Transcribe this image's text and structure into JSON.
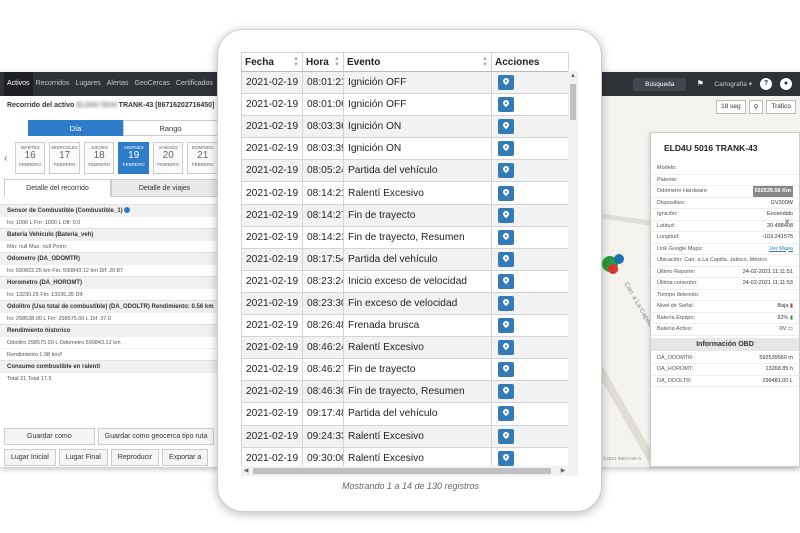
{
  "nav": {
    "tabs": [
      "Activos",
      "Recorridos",
      "Lugares",
      "Alertas",
      "GeoCercas",
      "Certificados"
    ],
    "search_label": "Búsqueda",
    "map_type_label": "Cartografía",
    "help_icon": "question-icon",
    "user_icon": "user-icon"
  },
  "route_panel": {
    "title_prefix": "Recorrido del activo",
    "title_blurred": "ELD4U 5016",
    "title_suffix": "TRANK-43 [86716202716450]",
    "mode_day": "Día",
    "mode_range": "Rango",
    "days": [
      {
        "name": "MARTES",
        "num": "16",
        "month": "FEBRERO"
      },
      {
        "name": "MIERCOLES",
        "num": "17",
        "month": "FEBRERO"
      },
      {
        "name": "JUEVES",
        "num": "18",
        "month": "FEBRERO"
      },
      {
        "name": "VIERNES",
        "num": "19",
        "month": "FEBRERO"
      },
      {
        "name": "SABADO",
        "num": "20",
        "month": "FEBRERO"
      },
      {
        "name": "DOMINGO",
        "num": "21",
        "month": "FEBRERO"
      }
    ],
    "tab_route_detail": "Detalle del recorrido",
    "tab_trip_detail": "Detalle de viajes",
    "sections": [
      {
        "title": "Sensor de Combustible (Combustible_1)",
        "row": "Ini:  1000 L   Fin:  1000 L   Dif:  0.0"
      },
      {
        "title": "Bateria Vehiculo (Bateria_veh)",
        "row": "Min:  null   Max:  null   Prom:"
      },
      {
        "title": "Odometro (DA_ODOMTR)",
        "row": "Ini:  590822.25 km   Fin:  590843.12 km   Dif:  20.87"
      },
      {
        "title": "Horometro (DA_HOROMT)",
        "row": "Ini:  13230.25   Fin:  13236.35   Dif:"
      },
      {
        "title": "Odolitro (Uso total de combustible) (DA_ODOLTR)  Rendimiento: 0.56 km",
        "row": "Ini:  298538.00 L   Fin:  298575.00 L   Dif:  37.0"
      },
      {
        "title": "Rendimiento historico",
        "row": "Odolitro  298575.00 L   Odometro  590843.12 km"
      },
      {
        "title": "",
        "row": "Rendimiento  1.98 km/l"
      },
      {
        "title": "Consumo combustible en ralenti",
        "row": "Total  21   Total  17.5"
      }
    ],
    "btn_save_as": "Guardar como",
    "btn_save_geofence": "Guardar como geocerca tipo ruta",
    "btn_start_place": "Lugar Inicial",
    "btn_end_place": "Lugar Final",
    "btn_replay": "Reproducir",
    "btn_export": "Exportar a"
  },
  "map": {
    "interval_label": "18 seg",
    "traffic_label": "Tráfico",
    "road_label": "Carr. a La Capilla",
    "attribution": "©2021 INEGI   50 m",
    "marker_badge": "20"
  },
  "vehicle_panel": {
    "title": "ELD4U 5016 TRANK-43",
    "rows": [
      {
        "label": "Modelo:",
        "value": ""
      },
      {
        "label": "Patente:",
        "value": ""
      },
      {
        "label": "Odómetro Hardware:",
        "value": "592539.56 Km",
        "style": "hl"
      },
      {
        "label": "Dispositivo:",
        "value": "GV300W"
      },
      {
        "label": "Ignición:",
        "value": "Encendido"
      },
      {
        "label": "Latitud:",
        "value": "20.488408"
      },
      {
        "label": "Longitud:",
        "value": "-103.241575"
      },
      {
        "label": "Link Google Maps:",
        "value": "Ver Mapa",
        "style": "link"
      },
      {
        "label": "Ubicación: Carr. a La Capilla, Jalisco, México",
        "value": ""
      },
      {
        "label": "Último Reporte:",
        "value": "24-02-2021 11:11:51"
      },
      {
        "label": "Última conexión:",
        "value": "24-02-2021 11:11:53"
      },
      {
        "label": "Tiempo detenido:",
        "value": ""
      },
      {
        "label": "Nivel de Señal:",
        "value": "Baja"
      },
      {
        "label": "Batería Equipo:",
        "value": "92%"
      },
      {
        "label": "Batería Activo:",
        "value": "0V"
      }
    ],
    "obd_title": "Información OBD",
    "obd_rows": [
      {
        "label": "DA_ODOMTR:",
        "value": "592539560 m"
      },
      {
        "label": "DA_HOROMT:",
        "value": "13268.85 h"
      },
      {
        "label": "DA_ODOLTR:",
        "value": "299481.00 L"
      }
    ]
  },
  "events_table": {
    "columns": [
      "Fecha",
      "Hora",
      "Evento",
      "Acciones"
    ],
    "rows": [
      {
        "date": "2021-02-19",
        "time": "08:01:21",
        "event": "Ignición OFF"
      },
      {
        "date": "2021-02-19",
        "time": "08:01:06",
        "event": "Ignición OFF"
      },
      {
        "date": "2021-02-19",
        "time": "08:03:36",
        "event": "Ignición ON"
      },
      {
        "date": "2021-02-19",
        "time": "08:03:39",
        "event": "Ignición ON"
      },
      {
        "date": "2021-02-19",
        "time": "08:05:24",
        "event": "Partida del vehículo"
      },
      {
        "date": "2021-02-19",
        "time": "08:14:21",
        "event": "Ralentí Excesivo"
      },
      {
        "date": "2021-02-19",
        "time": "08:14:27",
        "event": "Fin de trayecto"
      },
      {
        "date": "2021-02-19",
        "time": "08:14:21",
        "event": "Fin de trayecto, Resumen"
      },
      {
        "date": "2021-02-19",
        "time": "08:17:54",
        "event": "Partida del vehículo"
      },
      {
        "date": "2021-02-19",
        "time": "08:23:24",
        "event": "Inicio exceso de velocidad"
      },
      {
        "date": "2021-02-19",
        "time": "08:23:30",
        "event": "Fin exceso de velocidad"
      },
      {
        "date": "2021-02-19",
        "time": "08:26:48",
        "event": "Frenada brusca"
      },
      {
        "date": "2021-02-19",
        "time": "08:46:24",
        "event": "Ralentí Excesivo"
      },
      {
        "date": "2021-02-19",
        "time": "08:46:27",
        "event": "Fin de trayecto"
      },
      {
        "date": "2021-02-19",
        "time": "08:46:30",
        "event": "Fin de trayecto, Resumen"
      },
      {
        "date": "2021-02-19",
        "time": "09:17:48",
        "event": "Partida del vehículo"
      },
      {
        "date": "2021-02-19",
        "time": "09:24:33",
        "event": "Ralentí Excesivo"
      },
      {
        "date": "2021-02-19",
        "time": "09:30:00",
        "event": "Ralentí Excesivo"
      }
    ],
    "action_icon": "map-pin-icon",
    "info_text": "Mostrando 1 a 14 de 130 registros"
  },
  "colors": {
    "primary": "#337ab7",
    "nav_bg": "#2f3237",
    "active_tab": "#2f7dc9"
  }
}
